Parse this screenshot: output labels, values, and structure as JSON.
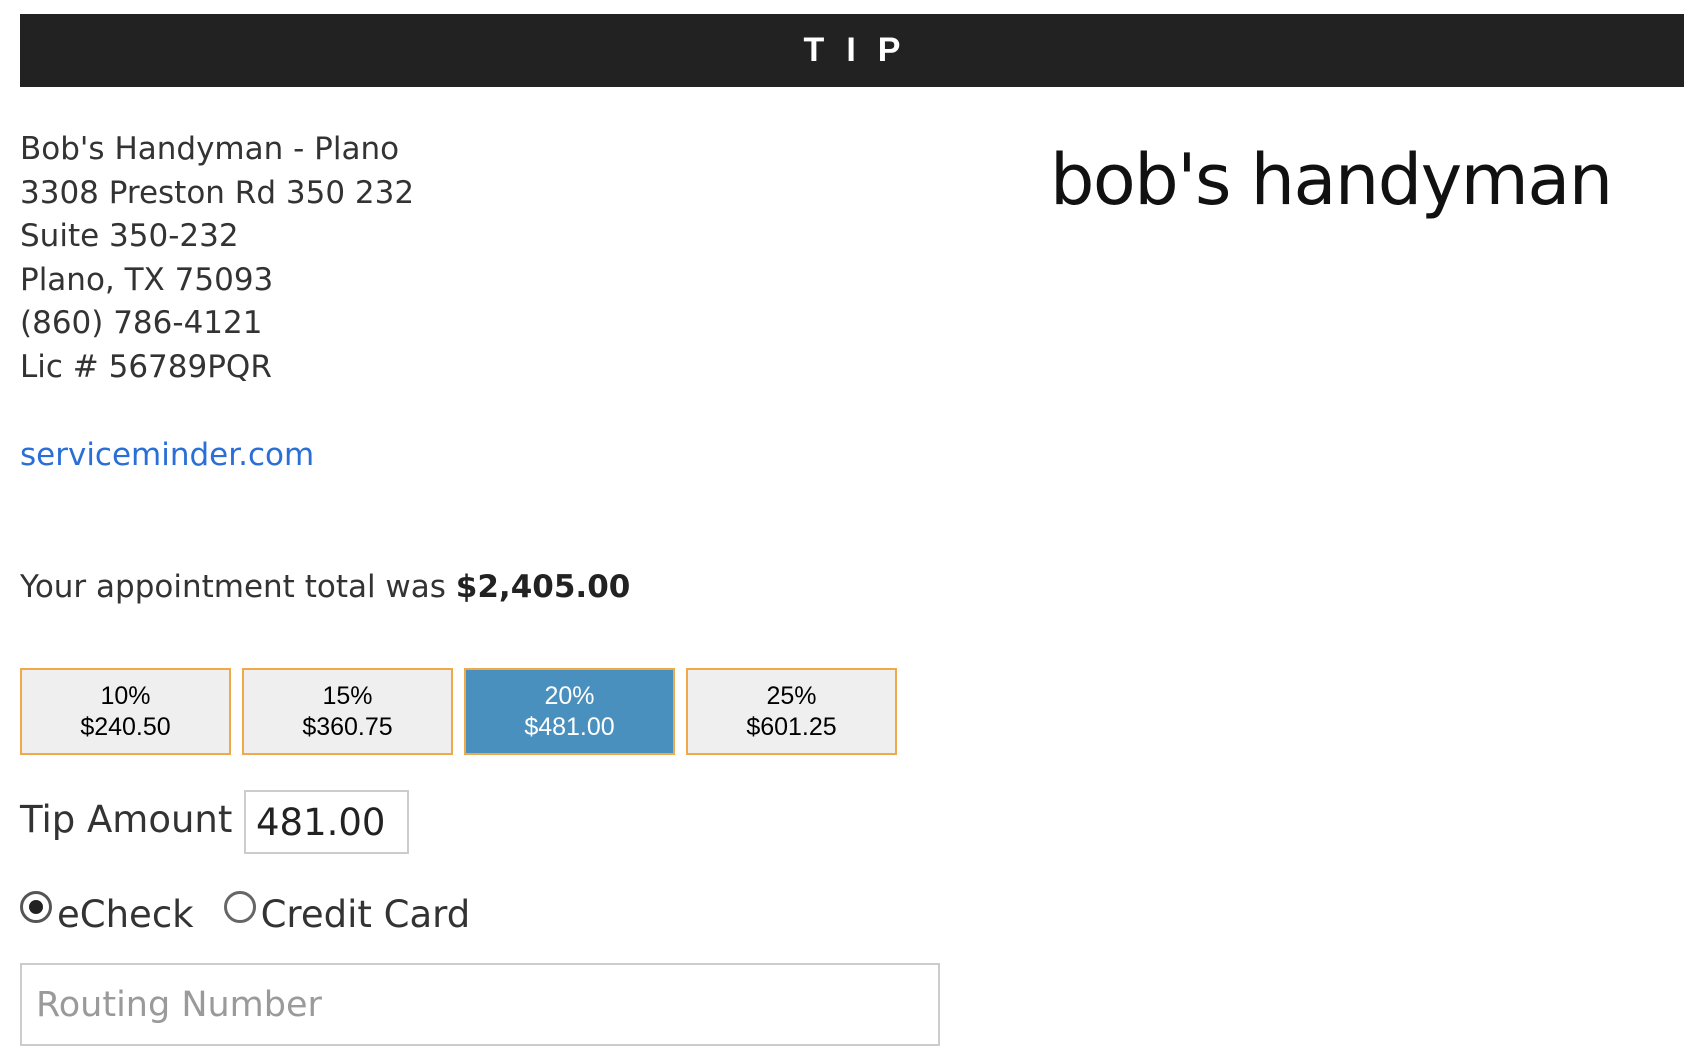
{
  "header": {
    "title": "TIP"
  },
  "business": {
    "name": "Bob's Handyman - Plano",
    "address_line1": "3308 Preston Rd 350 232",
    "address_line2": "Suite 350-232",
    "city_state_zip": "Plano, TX 75093",
    "phone": "(860) 786-4121",
    "license": "Lic # 56789PQR",
    "website": "serviceminder.com",
    "logo_text": "bob's handyman"
  },
  "appointment": {
    "total_prefix": "Your appointment total was",
    "total_amount": "$2,405.00"
  },
  "tip_options": [
    {
      "percent": "10%",
      "amount": "$240.50",
      "selected": false
    },
    {
      "percent": "15%",
      "amount": "$360.75",
      "selected": false
    },
    {
      "percent": "20%",
      "amount": "$481.00",
      "selected": true
    },
    {
      "percent": "25%",
      "amount": "$601.25",
      "selected": false
    }
  ],
  "tip_amount": {
    "label": "Tip Amount",
    "value": "481.00"
  },
  "payment_methods": {
    "echeck_label": "eCheck",
    "credit_card_label": "Credit Card",
    "selected": "eCheck"
  },
  "routing": {
    "placeholder": "Routing Number",
    "value": ""
  },
  "colors": {
    "header_bg": "#222222",
    "link": "#2a6fd6",
    "tip_selected_bg": "#4a90bf",
    "tip_border": "#f0a94a",
    "tip_bg": "#efefef"
  }
}
